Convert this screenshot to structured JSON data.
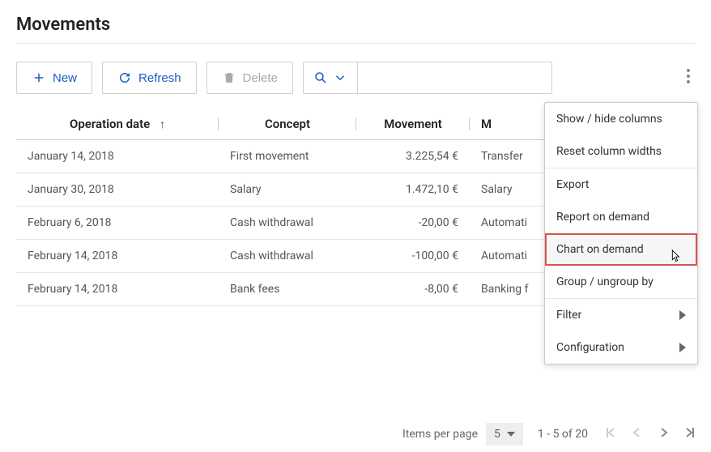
{
  "title": "Movements",
  "toolbar": {
    "new_label": "New",
    "refresh_label": "Refresh",
    "delete_label": "Delete",
    "search_placeholder": ""
  },
  "columns": {
    "date": "Operation date",
    "concept": "Concept",
    "movement": "Movement",
    "mtype": "M"
  },
  "rows": [
    {
      "date": "January 14, 2018",
      "concept": "First movement",
      "amount": "3.225,54 €",
      "mtype": "Transfer"
    },
    {
      "date": "January 30, 2018",
      "concept": "Salary",
      "amount": "1.472,10 €",
      "mtype": "Salary"
    },
    {
      "date": "February 6, 2018",
      "concept": "Cash withdrawal",
      "amount": "-20,00 €",
      "mtype": "Automati"
    },
    {
      "date": "February 14, 2018",
      "concept": "Cash withdrawal",
      "amount": "-100,00 €",
      "mtype": "Automati"
    },
    {
      "date": "February 14, 2018",
      "concept": "Bank fees",
      "amount": "-8,00 €",
      "mtype": "Banking f"
    }
  ],
  "menu": {
    "show_hide": "Show / hide columns",
    "reset_widths": "Reset column widths",
    "export": "Export",
    "report": "Report on demand",
    "chart": "Chart on demand",
    "group": "Group / ungroup by",
    "filter": "Filter",
    "config": "Configuration"
  },
  "footer": {
    "items_label": "Items per page",
    "items_value": "5",
    "range": "1 - 5 of 20"
  }
}
